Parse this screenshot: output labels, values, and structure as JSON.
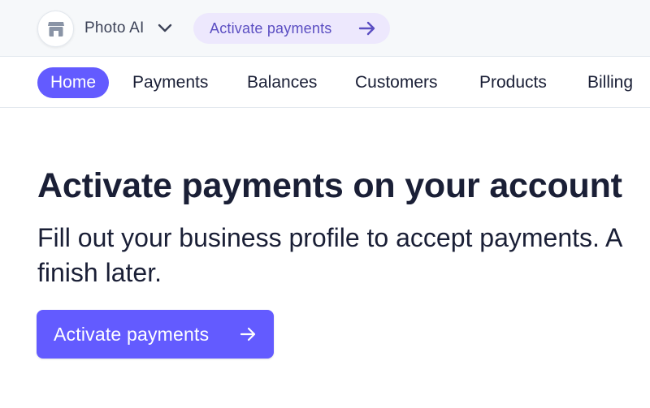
{
  "topbar": {
    "store_icon": "storefront-icon",
    "account_name": "Photo AI",
    "account_chevron_icon": "chevron-down-icon",
    "activate_pill_label": "Activate payments",
    "activate_pill_icon": "arrow-right-icon"
  },
  "nav": {
    "items": [
      {
        "label": "Home",
        "active": true
      },
      {
        "label": "Payments",
        "active": false
      },
      {
        "label": "Balances",
        "active": false
      },
      {
        "label": "Customers",
        "active": false
      },
      {
        "label": "Products",
        "active": false
      },
      {
        "label": "Billing",
        "active": false
      }
    ]
  },
  "main": {
    "headline": "Activate payments on your account",
    "subtext": "Fill out your business profile to accept payments. A finish later.",
    "cta_label": "Activate payments",
    "cta_icon": "arrow-right-icon"
  },
  "colors": {
    "accent": "#635bff",
    "pill_bg": "#ede8fd",
    "pill_text": "#5b4ec2",
    "topbar_bg": "#f6f8fa",
    "text": "#1a1f36"
  }
}
